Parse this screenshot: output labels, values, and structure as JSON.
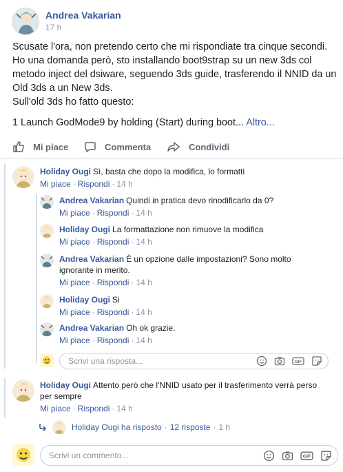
{
  "post": {
    "author": "Andrea Vakarian",
    "time": "17 h",
    "lines": [
      "Scusate l'ora, non pretendo certo che mi rispondiate tra cinque secondi.",
      "Ho una domanda però, sto installando boot9strap su un new 3ds col",
      "metodo inject del dsiware, seguendo 3ds guide, trasferendo il NNID da un",
      "Old 3ds a un New 3ds.",
      "Sull'old 3ds ho fatto questo:"
    ],
    "last_line": "1 Launch GodMode9 by holding (Start) during boot...",
    "more_label": "Altro..."
  },
  "actions": {
    "like": "Mi piace",
    "comment": "Commenta",
    "share": "Condividi"
  },
  "labels": {
    "like": "Mi piace",
    "reply": "Rispondi",
    "dot": "·"
  },
  "comments": [
    {
      "author": "Holiday Ougi",
      "text": "Sì, basta che dopo la modifica, lo formatti",
      "time": "14 h",
      "replies": [
        {
          "author": "Andrea Vakarian",
          "text": "Quindi in pratica devo rinodificarlo da 0?",
          "time": "14 h"
        },
        {
          "author": "Holiday Ougi",
          "text": "La formattazione non rimuove la modifica",
          "time": "14 h"
        },
        {
          "author": "Andrea Vakarian",
          "text": "È un opzione dalle impostazioni? Sono molto",
          "text2": "ignorante in merito.",
          "time": "14 h"
        },
        {
          "author": "Holiday Ougi",
          "text": "Si",
          "time": "14 h"
        },
        {
          "author": "Andrea Vakarian",
          "text": "Oh ok grazie.",
          "time": "14 h"
        }
      ],
      "reply_placeholder": "Scrivi una risposta..."
    },
    {
      "author": "Holiday Ougi",
      "text": "Attento però che l'NNID usato per il trasferimento verrà perso",
      "text2": "per sempre",
      "time": "14 h",
      "more_replies": {
        "label": "Holiday Ougi ha risposto",
        "count": "12 risposte",
        "time": "1 h"
      }
    }
  ],
  "comment_placeholder": "Scrivi un commento...",
  "colors": {
    "link": "#385898",
    "text": "#1c1e21",
    "meta": "#90949c",
    "thread": "#d6dbe4"
  }
}
